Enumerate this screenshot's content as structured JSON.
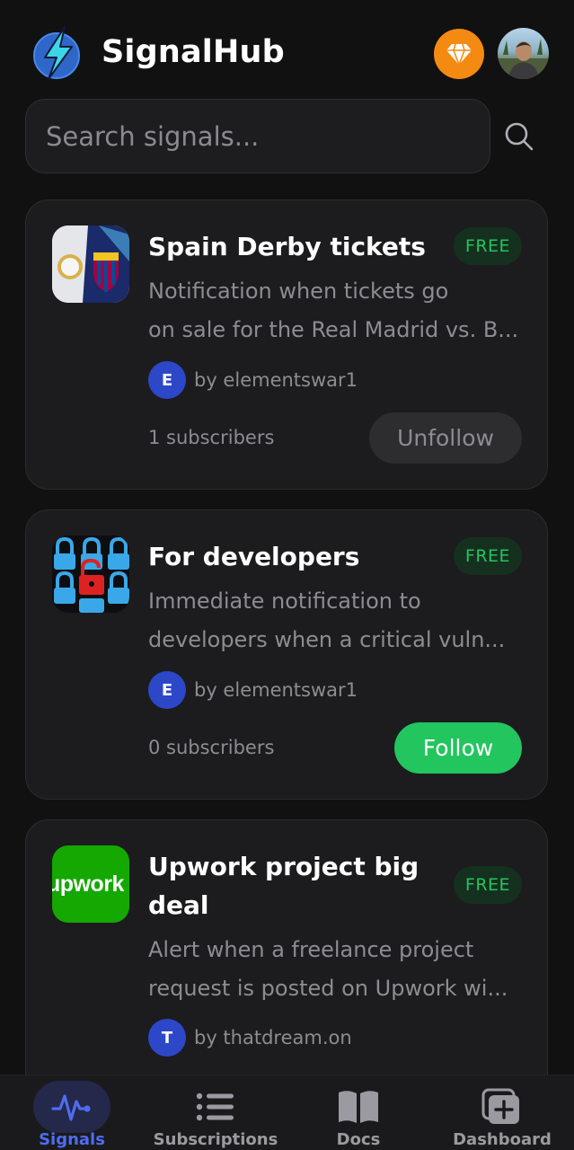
{
  "app": {
    "title": "SignalHub"
  },
  "search": {
    "placeholder": "Search signals..."
  },
  "signals": [
    {
      "title": "Spain Derby tickets",
      "badge": "FREE",
      "desc_line1": "Notification when tickets go",
      "desc_line2": "on sale for the Real Madrid vs. B...",
      "author_initial": "E",
      "author": "by elementswar1",
      "subscribers": "1 subscribers",
      "action_label": "Unfollow"
    },
    {
      "title": "For developers",
      "badge": "FREE",
      "desc_line1": "Immediate notification to",
      "desc_line2": "developers when a critical vuln...",
      "author_initial": "E",
      "author": "by elementswar1",
      "subscribers": "0 subscribers",
      "action_label": "Follow"
    },
    {
      "title_line1": "Upwork project big",
      "title_line2": "deal",
      "thumb_text": "upwork",
      "badge": "FREE",
      "desc_line1": "Alert when a freelance project",
      "desc_line2": "request is posted on Upwork wi...",
      "author_initial": "T",
      "author": "by thatdream.on"
    }
  ],
  "nav": [
    {
      "label": "Signals",
      "icon": "pulse-icon",
      "active": true
    },
    {
      "label": "Subscriptions",
      "icon": "list-icon"
    },
    {
      "label": "Docs",
      "icon": "book-icon"
    },
    {
      "label": "Dashboard",
      "icon": "add-square-icon"
    }
  ],
  "colors": {
    "background": "#111112",
    "card": "#1c1c1e",
    "accent_green": "#22c55e",
    "accent_blue": "#4f6cf0",
    "premium_orange": "#f58a12"
  }
}
